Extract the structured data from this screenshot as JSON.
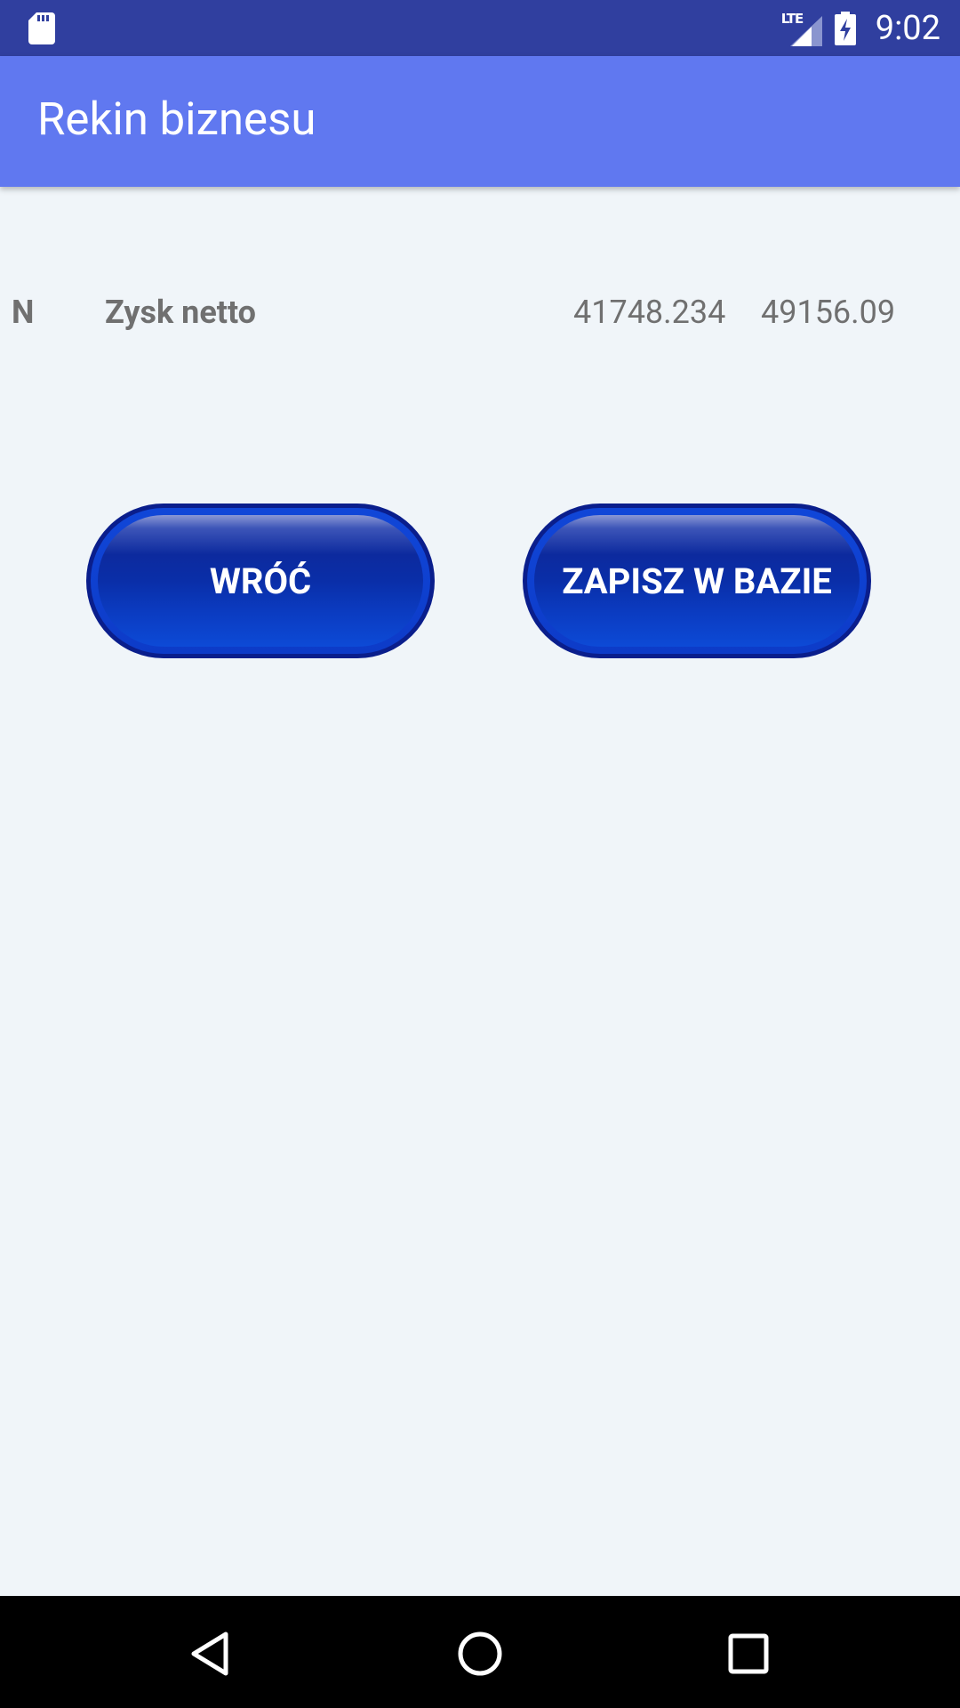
{
  "status_bar": {
    "time": "9:02",
    "network_label": "LTE",
    "icons": [
      "sd-card-icon",
      "lte-signal-icon",
      "battery-charging-icon"
    ]
  },
  "app_bar": {
    "title": "Rekin biznesu"
  },
  "data_row": {
    "code": "N",
    "label": "Zysk netto",
    "value_1": "41748.234",
    "value_2": "49156.09"
  },
  "buttons": {
    "back_label": "WRÓĆ",
    "save_label": "ZAPISZ W BAZIE"
  },
  "nav_bar": {
    "icons": [
      "back-icon",
      "home-icon",
      "recents-icon"
    ]
  },
  "colors": {
    "status_bar": "#303f9f",
    "app_bar": "#6078f0",
    "background": "#f0f5f9",
    "button_blue": "#0a2ea8",
    "row_text": "#707070"
  }
}
